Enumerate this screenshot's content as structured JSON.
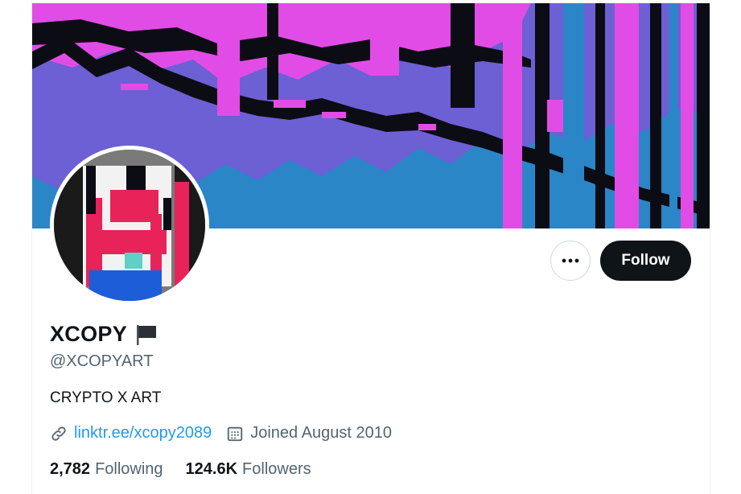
{
  "profile": {
    "display_name": "XCOPY",
    "handle": "@XCOPYART",
    "bio": "CRYPTO X ART",
    "website": "linktr.ee/xcopy2089",
    "joined": "Joined August 2010",
    "following_count": "2,782",
    "following_label": "Following",
    "followers_count": "124.6K",
    "followers_label": "Followers"
  },
  "actions": {
    "follow_label": "Follow",
    "more_icon": "more-horizontal-icon"
  },
  "icons": {
    "name_badge": "flag-icon",
    "website": "link-icon",
    "joined": "calendar-icon"
  },
  "colors": {
    "link": "#1d9bf0",
    "follow_bg": "#0f1419",
    "secondary_text": "#536471",
    "banner_magenta": "#e24ce6",
    "banner_blue": "#2b86c8",
    "banner_purple": "#6d5fd4"
  }
}
